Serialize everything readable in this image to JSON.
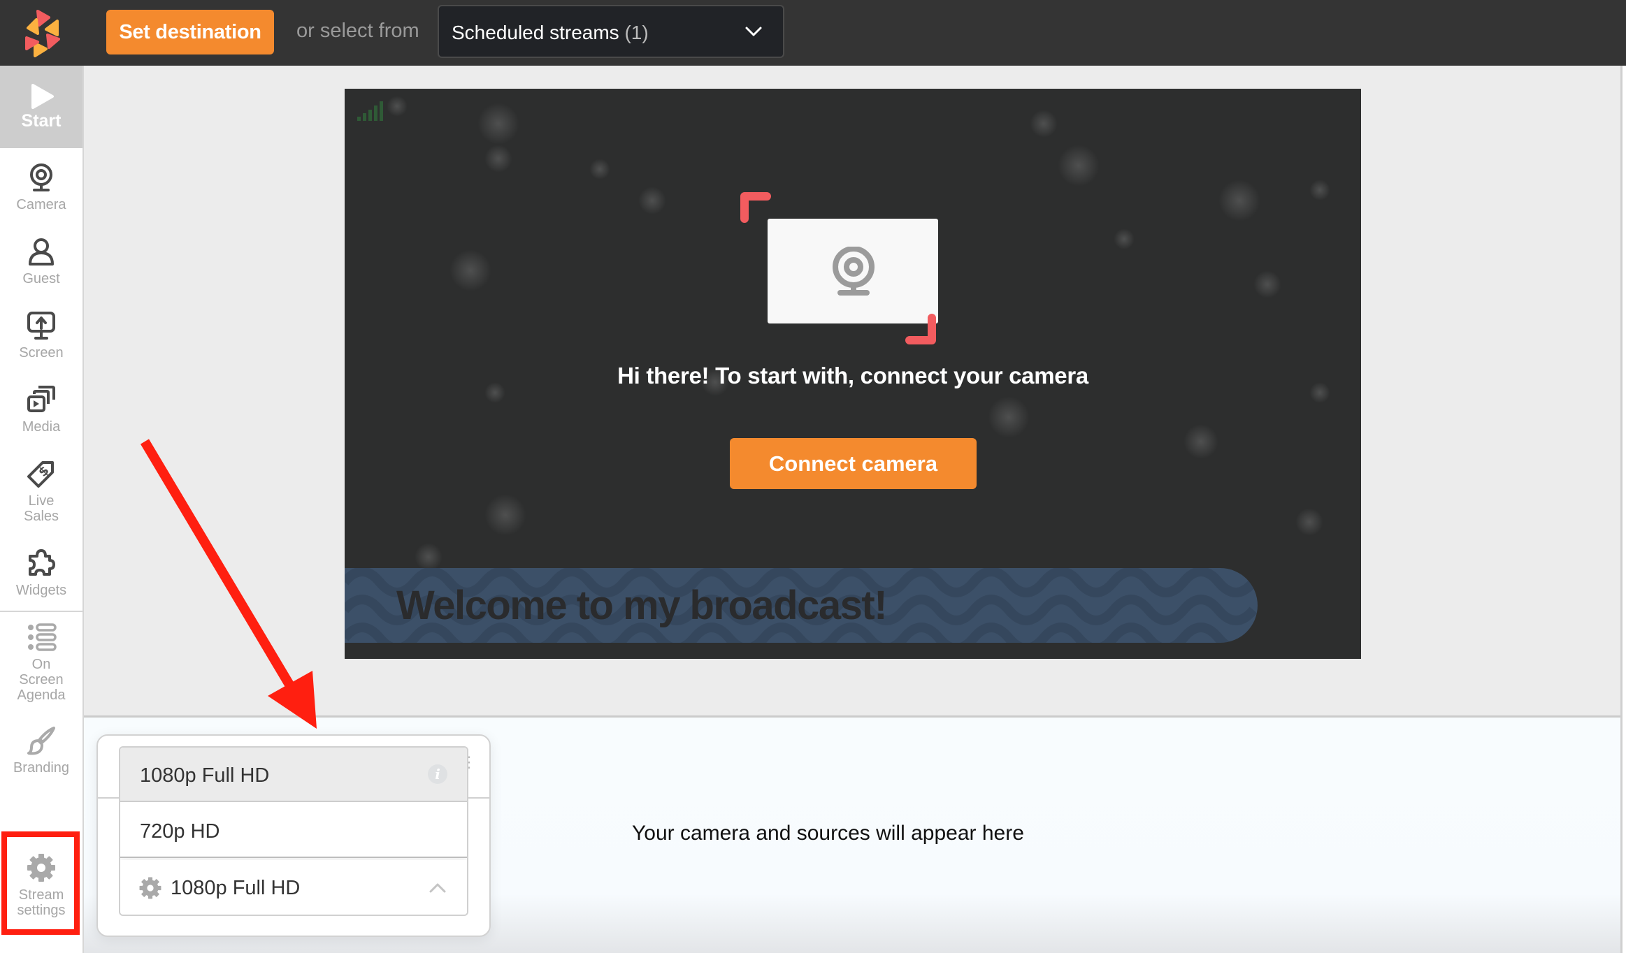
{
  "topbar": {
    "logo": "brand-logo",
    "set_destination_label": "Set destination",
    "or_select_from": "or select from",
    "scheduled_streams": {
      "label": "Scheduled streams",
      "count": "(1)"
    }
  },
  "sidebar": {
    "items": [
      {
        "id": "start",
        "label": "Start",
        "icon": "play-icon",
        "active": true
      },
      {
        "id": "camera",
        "label": "Camera",
        "icon": "webcam-icon"
      },
      {
        "id": "guest",
        "label": "Guest",
        "icon": "user-icon"
      },
      {
        "id": "screen",
        "label": "Screen",
        "icon": "screen-share-icon"
      },
      {
        "id": "media",
        "label": "Media",
        "icon": "media-stack-icon"
      },
      {
        "id": "live-sales",
        "label_line1": "Live",
        "label_line2": "Sales",
        "icon": "price-tag-icon"
      },
      {
        "id": "widgets",
        "label": "Widgets",
        "icon": "puzzle-icon"
      },
      {
        "id": "on-screen-agenda",
        "label_line1": "On",
        "label_line2": "Screen",
        "label_line3": "Agenda",
        "icon": "list-icon"
      },
      {
        "id": "branding",
        "label": "Branding",
        "icon": "brush-icon"
      },
      {
        "id": "stream-settings",
        "label_line1": "Stream",
        "label_line2": "settings",
        "icon": "gear-icon",
        "highlighted": true
      }
    ]
  },
  "preview": {
    "signal_icon": "signal-strength-icon",
    "prompt": "Hi there! To start with, connect your camera",
    "connect_button": "Connect camera",
    "banner_text": "Welcome to my broadcast!"
  },
  "sources_panel": {
    "empty_message": "Your camera and sources will appear here"
  },
  "quality_menu": {
    "options": [
      {
        "label": "1080p Full HD",
        "hover": true,
        "icon": "info-icon"
      },
      {
        "label": "720p HD"
      }
    ],
    "selected": "1080p Full HD",
    "info_glyph": "i"
  },
  "colors": {
    "accent_orange": "#f48a2e",
    "topbar_bg": "#343434",
    "bracket_red": "#f25c5f",
    "annotation_red": "#ff1f10",
    "banner_blue": "#3c5068"
  }
}
